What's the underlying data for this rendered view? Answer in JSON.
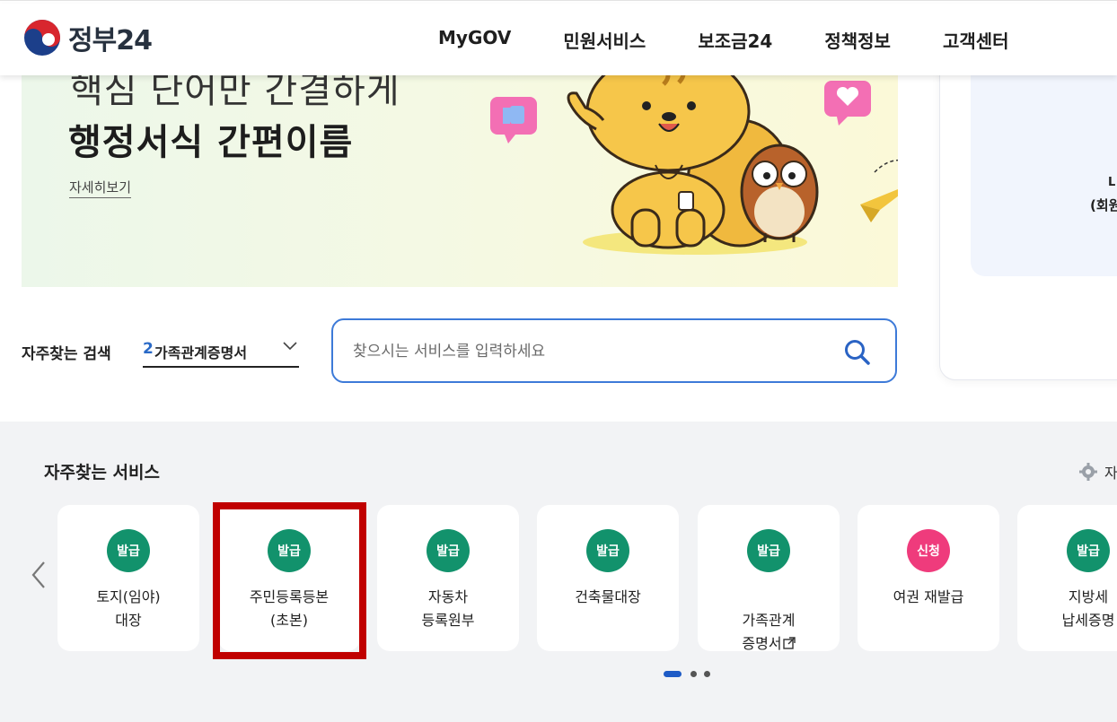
{
  "header": {
    "logo_text": "정부24",
    "nav": [
      "MyGOV",
      "민원서비스",
      "보조금24",
      "정책정보",
      "고객센터"
    ]
  },
  "hero": {
    "line1": "핵심 단어만 간결하게",
    "line2": "행정서식 간편이름",
    "more_label": "자세히보기"
  },
  "side_panel": {
    "text1": "L",
    "text2": "(회원"
  },
  "search": {
    "label": "자주찾는 검색",
    "selected_rank": "2",
    "selected_term": "가족관계증명서",
    "placeholder": "찾으시는 서비스를 입력하세요"
  },
  "services": {
    "title": "자주찾는 서비스",
    "settings_label": "자",
    "items": [
      {
        "badge": "발급",
        "badge_color": "#12926c",
        "label": "토지(임야)\n대장"
      },
      {
        "badge": "발급",
        "badge_color": "#12926c",
        "label": "주민등록등본\n(초본)"
      },
      {
        "badge": "발급",
        "badge_color": "#12926c",
        "label": "자동차\n등록원부"
      },
      {
        "badge": "발급",
        "badge_color": "#12926c",
        "label": "건축물대장"
      },
      {
        "badge": "발급",
        "badge_color": "#12926c",
        "label": "가족관계\n증명서"
      },
      {
        "badge": "신청",
        "badge_color": "#ef3b7c",
        "label": "여권 재발급"
      },
      {
        "badge": "발급",
        "badge_color": "#12926c",
        "label": "지방세\n납세증명"
      }
    ],
    "page_indicator": {
      "total": 3,
      "active": 1
    }
  },
  "colors": {
    "accent_blue": "#1e5bc6",
    "highlight_red": "#c00000"
  }
}
